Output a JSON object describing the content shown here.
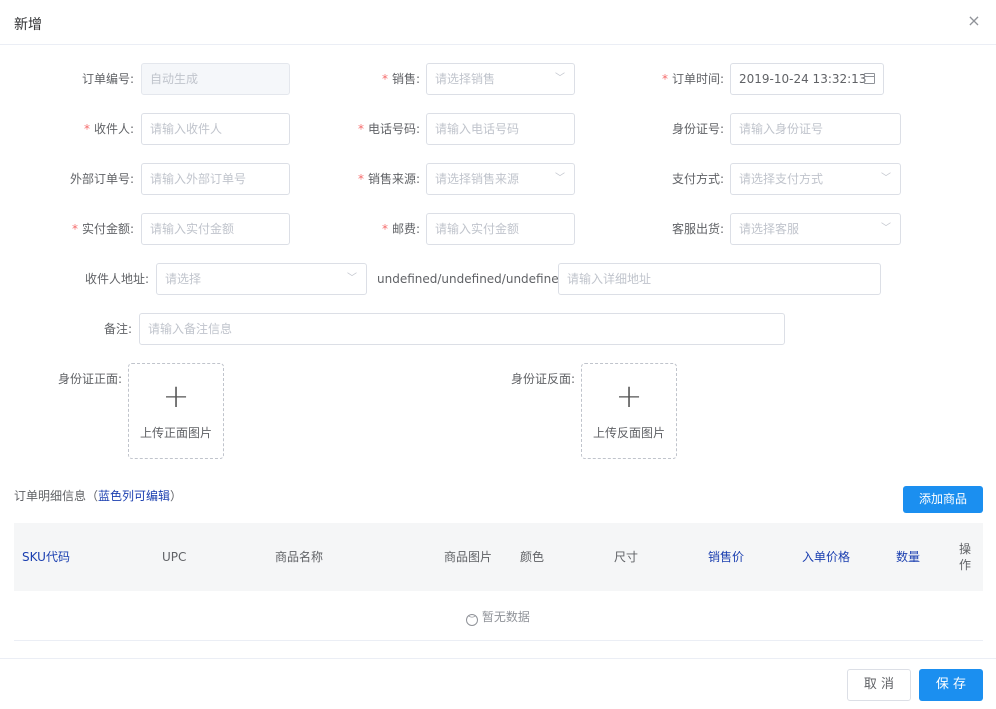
{
  "dialog": {
    "title": "新增",
    "close_symbol": "×"
  },
  "form": {
    "order_no": {
      "label": "订单编号:",
      "value": "自动生成"
    },
    "sales": {
      "label": "销售:",
      "placeholder": "请选择销售"
    },
    "order_time": {
      "label": "订单时间:",
      "value": "2019-10-24 13:32:13"
    },
    "receiver": {
      "label": "收件人:",
      "placeholder": "请输入收件人"
    },
    "phone": {
      "label": "电话号码:",
      "placeholder": "请输入电话号码"
    },
    "id_no": {
      "label": "身份证号:",
      "placeholder": "请输入身份证号"
    },
    "ext_order_no": {
      "label": "外部订单号:",
      "placeholder": "请输入外部订单号"
    },
    "sales_source": {
      "label": "销售来源:",
      "placeholder": "请选择销售来源"
    },
    "pay_method": {
      "label": "支付方式:",
      "placeholder": "请选择支付方式"
    },
    "paid_amount": {
      "label": "实付金额:",
      "placeholder": "请输入实付金额"
    },
    "postage": {
      "label": "邮费:",
      "placeholder": "请输入实付金额"
    },
    "cs_ship": {
      "label": "客服出货:",
      "placeholder": "请选择客服"
    },
    "address": {
      "label": "收件人地址:",
      "placeholder": "请选择",
      "region_text": "undefined/undefined/undefined",
      "detail_placeholder": "请输入详细地址"
    },
    "remark": {
      "label": "备注:",
      "placeholder": "请输入备注信息"
    },
    "id_front": {
      "label": "身份证正面:",
      "upload_text": "上传正面图片"
    },
    "id_back": {
      "label": "身份证反面:",
      "upload_text": "上传反面图片"
    }
  },
  "details": {
    "title": "订单明细信息（",
    "title_hint": "蓝色列可编辑",
    "title_end": "）",
    "add_button": "添加商品",
    "columns": [
      "SKU代码",
      "UPC",
      "商品名称",
      "商品图片",
      "颜色",
      "尺寸",
      "销售价",
      "入单价格",
      "数量",
      "操作"
    ],
    "empty_text": "暂无数据"
  },
  "footer": {
    "cancel": "取 消",
    "save": "保 存"
  },
  "colors": {
    "primary": "#1b8ff0",
    "required": "#f56c6c",
    "editable_column": "#1b3fb0"
  },
  "icons": {
    "dropdown": "chevron-down-icon",
    "calendar": "calendar-icon",
    "upload": "plus-icon",
    "empty": "frown-icon"
  }
}
